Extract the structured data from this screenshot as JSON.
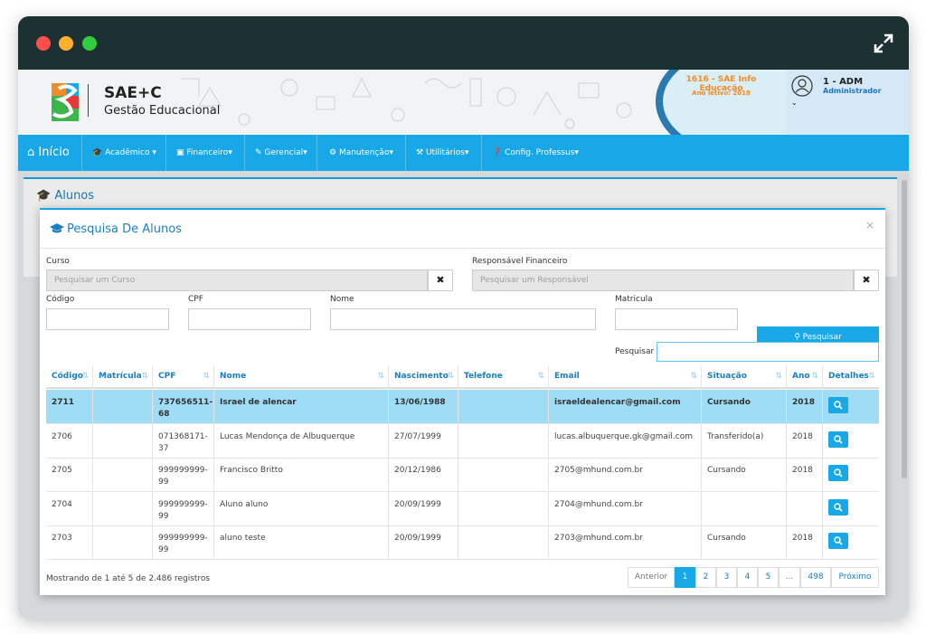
{
  "brand": {
    "name": "SAE+C",
    "subtitle": "Gestão Educacional",
    "colors": {
      "orange": "#f28c28",
      "blue": "#18a8e8",
      "green": "#3cb54a",
      "red": "#e53935"
    }
  },
  "school": {
    "name": "1616 - SAE Info Educação",
    "year": "Ano letivo: 2018"
  },
  "user": {
    "name": "1 - ADM",
    "role": "Administrador",
    "caret": "⌄"
  },
  "nav": {
    "home": "Início",
    "items": [
      "Acadêmico ▾",
      "Financeiro▾",
      "Gerencial▾",
      "Manutenção▾",
      "Utilitários▾",
      "Config. Professus▾"
    ]
  },
  "page": {
    "title": "Alunos"
  },
  "modal": {
    "title": "Pesquisa De Alunos",
    "close": "×",
    "fields": {
      "curso_label": "Curso",
      "curso_placeholder": "Pesquisar um Curso",
      "resp_label": "Responsável Financeiro",
      "resp_placeholder": "Pesquisar um Responsável",
      "codigo_label": "Código",
      "cpf_label": "CPF",
      "nome_label": "Nome",
      "matricula_label": "Matricula",
      "clear": "✖"
    },
    "search_button": "Pesquisar",
    "filter_label": "Pesquisar"
  },
  "table": {
    "headers": [
      "Código",
      "Matrícula",
      "CPF",
      "Nome",
      "Nascimento",
      "Telefone",
      "Email",
      "Situação",
      "Ano",
      "Detalhes"
    ],
    "rows": [
      {
        "codigo": "2711",
        "matricula": "",
        "cpf": "737656511-68",
        "nome": "Israel de alencar",
        "nascimento": "13/06/1988",
        "telefone": "",
        "email": "israeldealencar@gmail.com",
        "situacao": "Cursando",
        "ano": "2018"
      },
      {
        "codigo": "2706",
        "matricula": "",
        "cpf": "071368171-37",
        "nome": "Lucas Mendonça de Albuquerque",
        "nascimento": "27/07/1999",
        "telefone": "",
        "email": "lucas.albuquerque.gk@gmail.com",
        "situacao": "Transferido(a)",
        "ano": "2018"
      },
      {
        "codigo": "2705",
        "matricula": "",
        "cpf": "999999999-99",
        "nome": "Francisco Britto",
        "nascimento": "20/12/1986",
        "telefone": "",
        "email": "2705@mhund.com.br",
        "situacao": "Cursando",
        "ano": "2018"
      },
      {
        "codigo": "2704",
        "matricula": "",
        "cpf": "999999999-99",
        "nome": "Aluno aluno",
        "nascimento": "20/09/1999",
        "telefone": "",
        "email": "2704@mhund.com.br",
        "situacao": "",
        "ano": ""
      },
      {
        "codigo": "2703",
        "matricula": "",
        "cpf": "999999999-99",
        "nome": "aluno teste",
        "nascimento": "20/09/1999",
        "telefone": "",
        "email": "2703@mhund.com.br",
        "situacao": "Cursando",
        "ano": "2018"
      }
    ],
    "selected_row": 0
  },
  "footer": {
    "info": "Mostrando de 1 até 5 de 2.486 registros",
    "pagination": [
      "Anterior",
      "1",
      "2",
      "3",
      "4",
      "5",
      "...",
      "498",
      "Próximo"
    ],
    "active_page": "1"
  },
  "icons": {
    "window_controls": [
      "close-dot",
      "minimize-dot",
      "maximize-dot"
    ],
    "expand": "expand-icon",
    "home": "home-icon",
    "graduation": "graduation-cap-icon",
    "search": "magnifier-icon",
    "sort": "sort-icon"
  }
}
